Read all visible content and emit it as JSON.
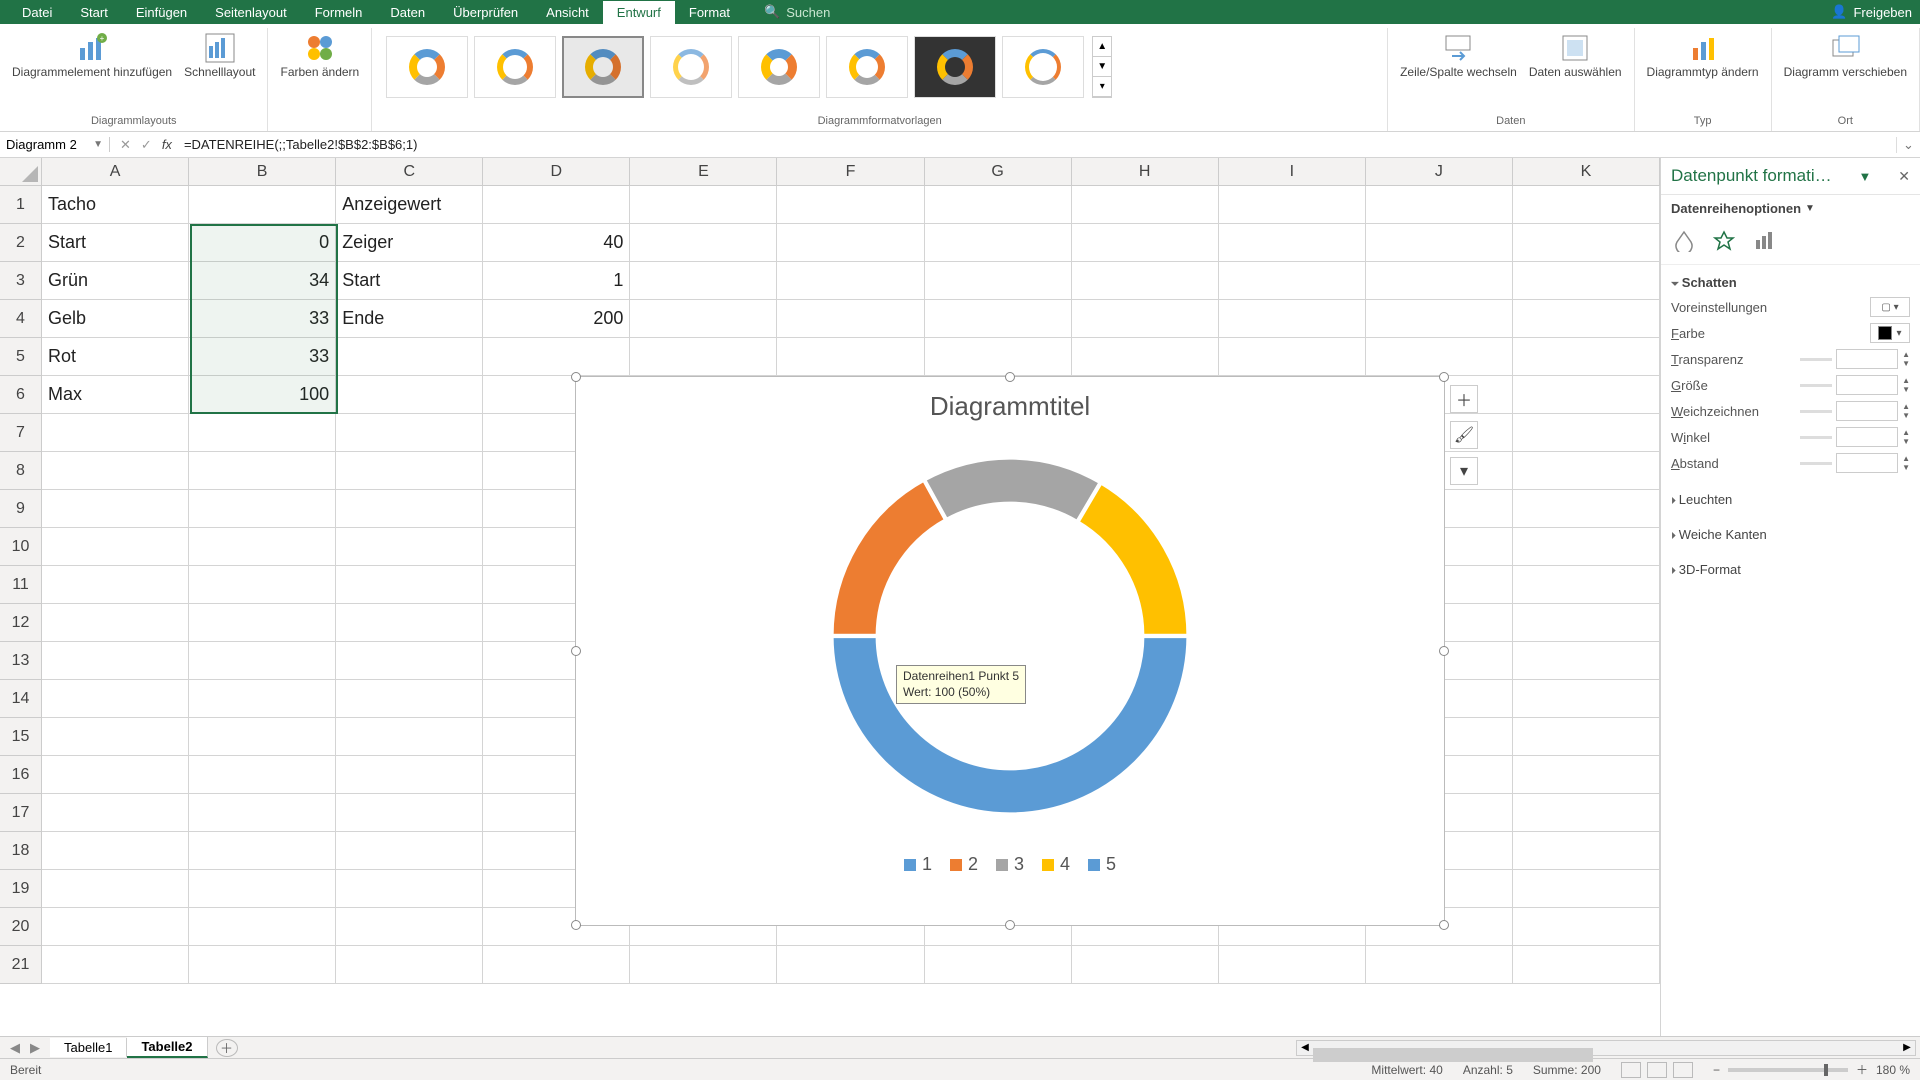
{
  "menu": {
    "tabs": [
      "Datei",
      "Start",
      "Einfügen",
      "Seitenlayout",
      "Formeln",
      "Daten",
      "Überprüfen",
      "Ansicht",
      "Entwurf",
      "Format"
    ],
    "active": "Entwurf",
    "search": "Suchen",
    "share": "Freigeben"
  },
  "ribbon": {
    "layouts": {
      "add_element": "Diagrammelement hinzufügen",
      "quick_layout": "Schnelllayout",
      "group": "Diagrammlayouts"
    },
    "colors": {
      "change": "Farben ändern"
    },
    "styles": {
      "group": "Diagrammformatvorlagen"
    },
    "data": {
      "switch": "Zeile/Spalte wechseln",
      "select": "Daten auswählen",
      "group": "Daten"
    },
    "type": {
      "change": "Diagrammtyp ändern",
      "group": "Typ"
    },
    "location": {
      "move": "Diagramm verschieben",
      "group": "Ort"
    }
  },
  "namebox": "Diagramm 2",
  "formula": "=DATENREIHE(;;Tabelle2!$B$2:$B$6;1)",
  "columns": [
    "A",
    "B",
    "C",
    "D",
    "E",
    "F",
    "G",
    "H",
    "I",
    "J",
    "K"
  ],
  "rows": 21,
  "cells": {
    "A1": "Tacho",
    "C1": "Anzeigewert",
    "A2": "Start",
    "B2": "0",
    "C2": "Zeiger",
    "D2": "40",
    "A3": "Grün",
    "B3": "34",
    "C3": "Start",
    "D3": "1",
    "A4": "Gelb",
    "B4": "33",
    "C4": "Ende",
    "D4": "200",
    "A5": "Rot",
    "B5": "33",
    "A6": "Max",
    "B6": "100"
  },
  "chart_data": {
    "type": "pie",
    "subtype": "doughnut",
    "title": "Diagrammtitel",
    "categories": [
      "1",
      "2",
      "3",
      "4",
      "5"
    ],
    "values": [
      0,
      34,
      33,
      33,
      100
    ],
    "colors": [
      "#5b9bd5",
      "#ed7d31",
      "#a5a5a5",
      "#ffc000",
      "#5b9bd5"
    ],
    "rotation_deg": 270,
    "hole_pct": 75,
    "legend": [
      "1",
      "2",
      "3",
      "4",
      "5"
    ],
    "tooltip": {
      "line1": "Datenreihen1 Punkt 5",
      "line2": "Wert: 100 (50%)"
    }
  },
  "taskpane": {
    "title": "Datenpunkt formati…",
    "subtitle": "Datenreihenoptionen",
    "sections": {
      "shadow": "Schatten",
      "glow": "Leuchten",
      "soft": "Weiche Kanten",
      "threeD": "3D-Format"
    },
    "shadow_props": {
      "presets": "Voreinstellungen",
      "color": "Farbe",
      "transparency": "Transparenz",
      "size": "Größe",
      "blur": "Weichzeichnen",
      "angle": "Winkel",
      "distance": "Abstand"
    }
  },
  "sheets": {
    "s1": "Tabelle1",
    "s2": "Tabelle2"
  },
  "statusbar": {
    "ready": "Bereit",
    "avg_label": "Mittelwert:",
    "avg": "40",
    "count_label": "Anzahl:",
    "count": "5",
    "sum_label": "Summe:",
    "sum": "200",
    "zoom": "180 %"
  }
}
